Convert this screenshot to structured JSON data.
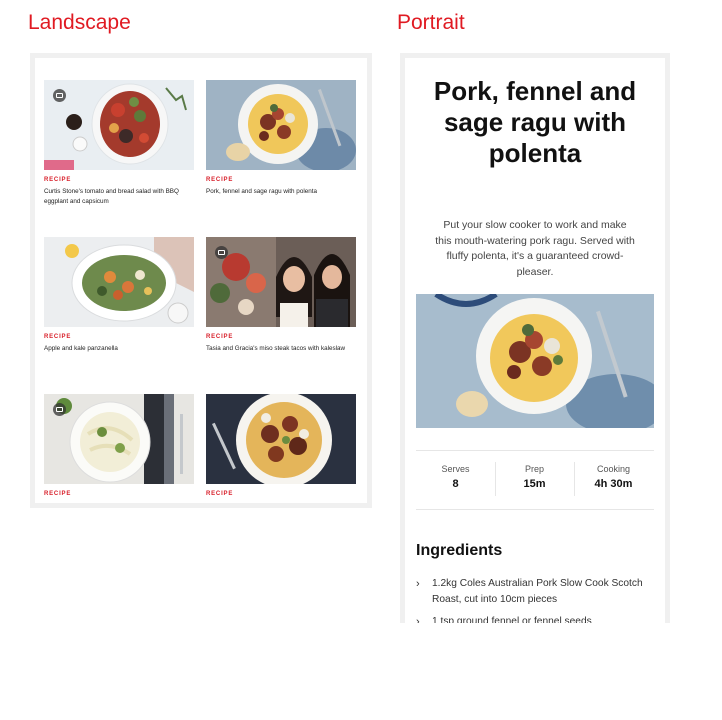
{
  "headings": {
    "landscape": "Landscape",
    "portrait": "Portrait"
  },
  "landscape": {
    "cards": [
      {
        "tag": "RECIPE",
        "title": "Curtis Stone's tomato and bread salad with BBQ eggplant and capsicum",
        "video": true
      },
      {
        "tag": "RECIPE",
        "title": "Pork, fennel and sage ragu with polenta",
        "video": false
      },
      {
        "tag": "RECIPE",
        "title": "Apple and kale panzanella",
        "video": false
      },
      {
        "tag": "RECIPE",
        "title": "Tasia and Gracia's miso steak tacos with kaleslaw",
        "video": true
      },
      {
        "tag": "RECIPE",
        "title": "",
        "video": true
      },
      {
        "tag": "RECIPE",
        "title": "",
        "video": false
      }
    ]
  },
  "portrait": {
    "title": "Pork, fennel and sage ragu with polenta",
    "description": "Put your slow cooker to work and make this mouth-watering pork ragu. Served with fluffy polenta, it's a guaranteed crowd-pleaser.",
    "stats": [
      {
        "label": "Serves",
        "value": "8"
      },
      {
        "label": "Prep",
        "value": "15m"
      },
      {
        "label": "Cooking",
        "value": "4h 30m"
      }
    ],
    "ingredients_heading": "Ingredients",
    "ingredients": [
      "1.2kg Coles Australian Pork Slow Cook Scotch Roast, cut into 10cm pieces",
      "1 tsp ground fennel or fennel seeds"
    ]
  },
  "colors": {
    "accent": "#e01a22",
    "recipe_tag": "#d81f2a"
  },
  "icons": {
    "video_badge": "video-camera-icon",
    "ingredient_bullet": "chevron-right-icon"
  }
}
